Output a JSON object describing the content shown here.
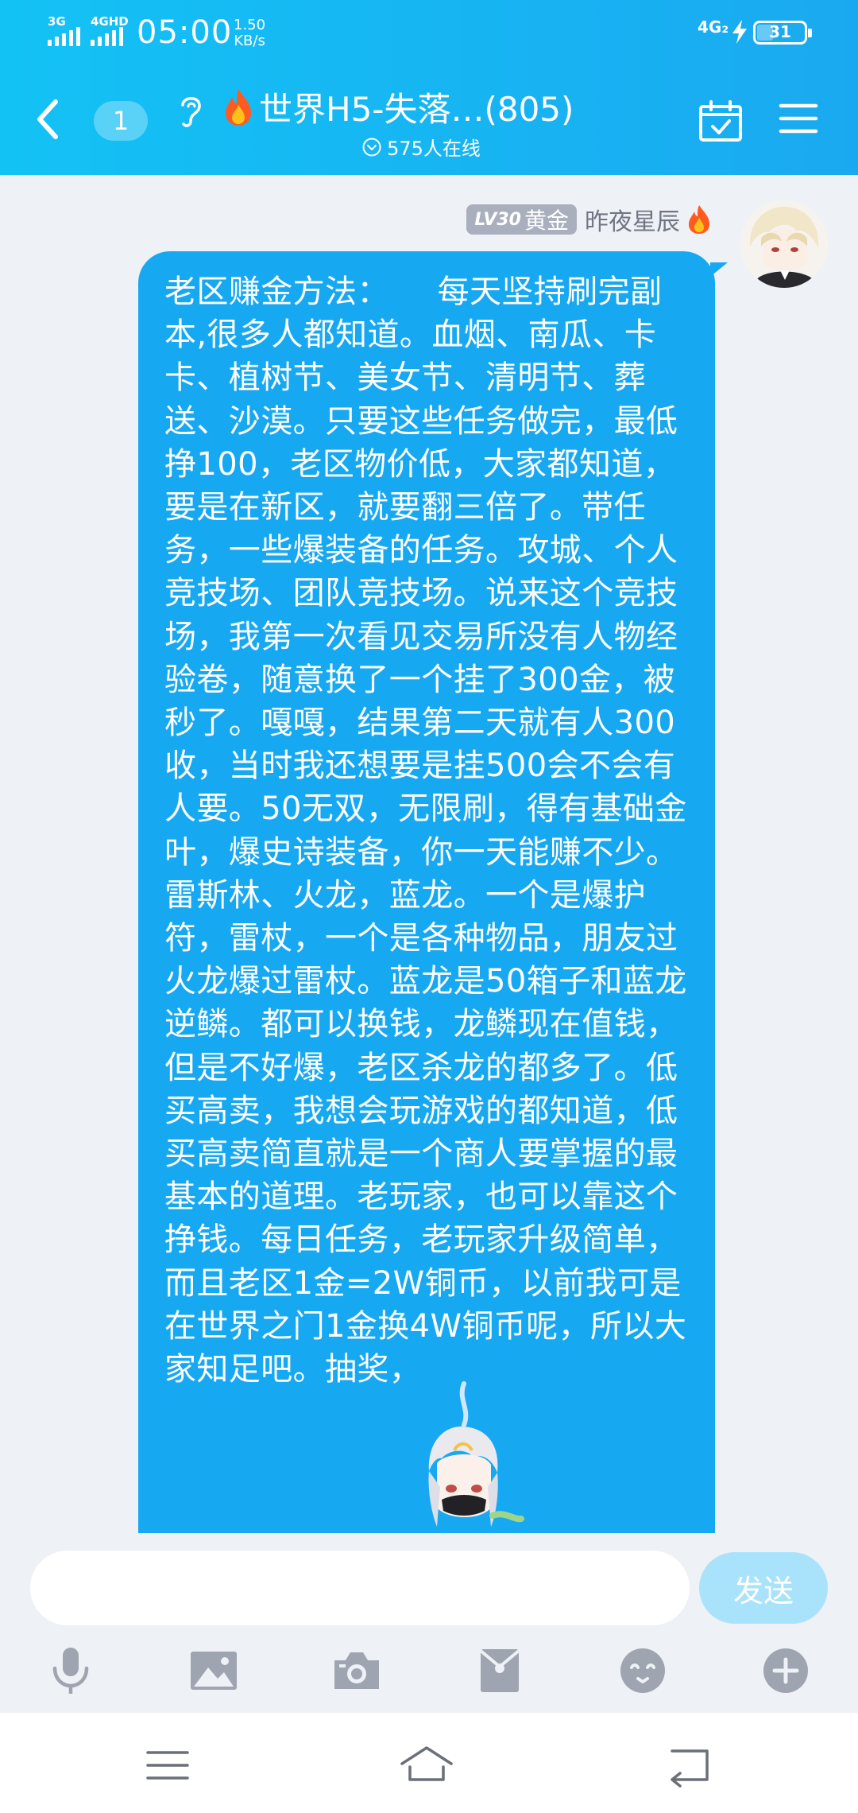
{
  "status_bar": {
    "sim1_label": "3G",
    "sim2_label": "4GHD",
    "time": "05:00",
    "net_speed_value": "1.50",
    "net_speed_unit": "KB/s",
    "network": "4G₂",
    "battery": "31"
  },
  "header": {
    "unread_count": "1",
    "title": "世界H5-失落…(805)",
    "online_count": "575人在线"
  },
  "message": {
    "level_prefix": "LV30",
    "level_title": "黄金",
    "sender_name": "昨夜星辰",
    "text": "老区赚金方法：　　每天坚持刷完副本,很多人都知道。血烟、南瓜、卡卡、植树节、美女节、清明节、葬送、沙漠。只要这些任务做完，最低挣100，老区物价低，大家都知道，要是在新区，就要翻三倍了。带任务，一些爆装备的任务。攻城、个人竞技场、团队竞技场。说来这个竞技场，我第一次看见交易所没有人物经验卷，随意换了一个挂了300金，被秒了。嘎嘎，结果第二天就有人300收，当时我还想要是挂500会不会有人要。50无双，无限刷，得有基础金叶，爆史诗装备，你一天能赚不少。雷斯林、火龙，蓝龙。一个是爆护符，雷杖，一个是各种物品，朋友过火龙爆过雷杖。蓝龙是50箱子和蓝龙逆鳞。都可以换钱，龙鳞现在值钱，但是不好爆，老区杀龙的都多了。低买高卖，我想会玩游戏的都知道，低买高卖简直就是一个商人要掌握的最基本的道理。老玩家，也可以靠这个挣钱。每日任务，老玩家升级简单，而且老区1金=2W铜币，以前我可是在世界之门1金换4W铜币呢，所以大家知足吧。抽奖，"
  },
  "composer": {
    "input_value": "",
    "send_label": "发送"
  },
  "colors": {
    "header_start": "#13c2f5",
    "header_end": "#1aa9f0",
    "bubble": "#17a8f2",
    "send_button": "#a9e3fb",
    "icon_gray": "#9ea4b0"
  },
  "icons": {
    "toolbar": [
      "microphone-icon",
      "image-icon",
      "camera-icon",
      "red-packet-icon",
      "emoji-icon",
      "plus-icon"
    ],
    "nav": [
      "menu-icon",
      "home-icon",
      "back-icon"
    ]
  }
}
